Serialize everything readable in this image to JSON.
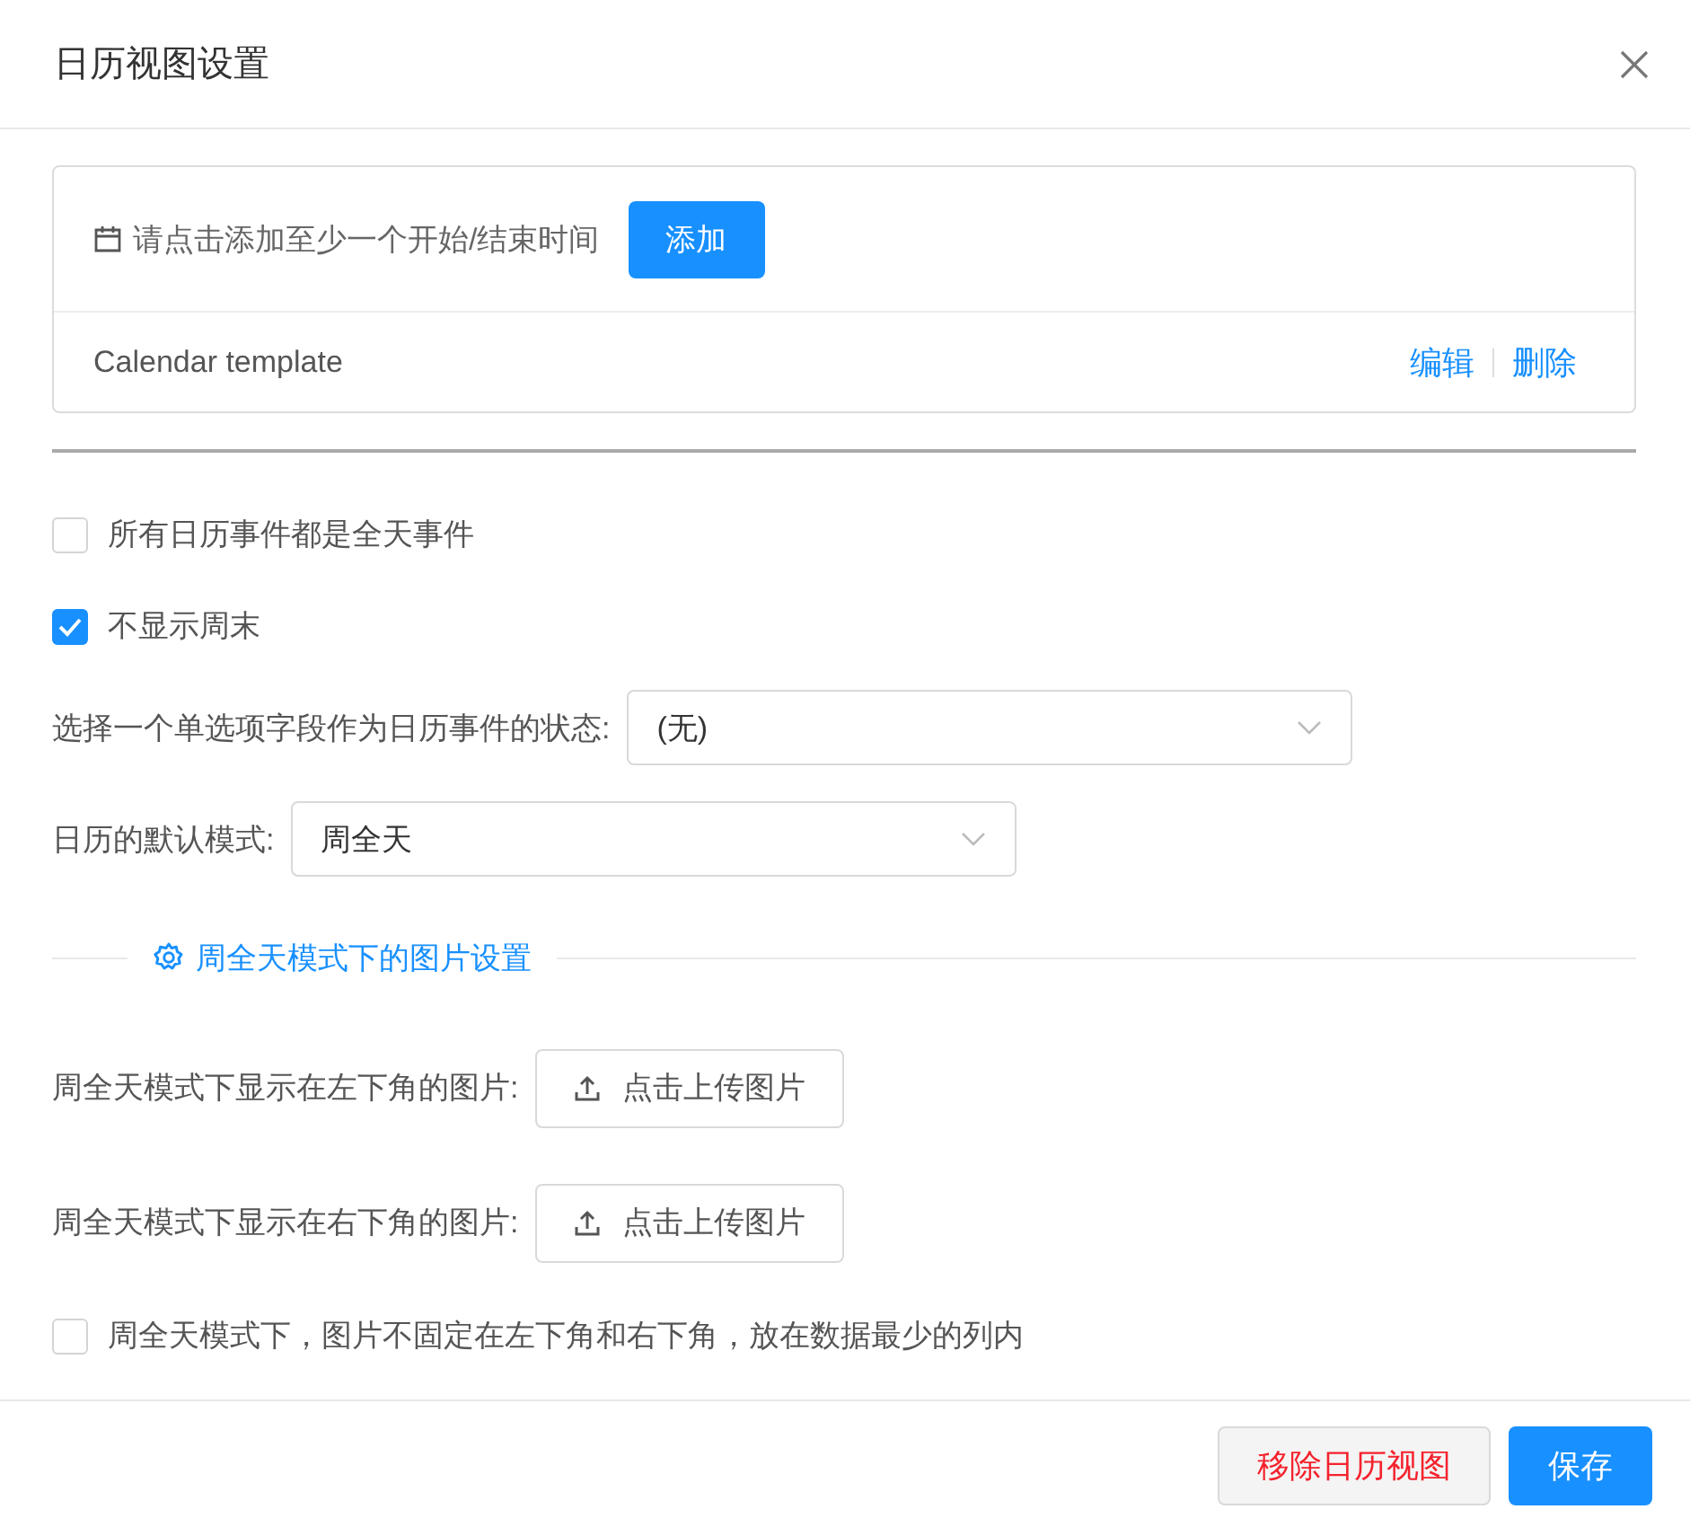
{
  "dialog": {
    "title": "日历视图设置"
  },
  "card": {
    "prompt": "请点击添加至少一个开始/结束时间",
    "add_button": "添加",
    "template_name": "Calendar template",
    "actions": [
      "编辑",
      "删除"
    ]
  },
  "settings": [
    {
      "kind": "checkbox",
      "label": "所有日历事件都是全天事件",
      "checked": false
    },
    {
      "kind": "checkbox",
      "label": "不显示周末",
      "checked": true
    },
    {
      "kind": "select",
      "label": "选择一个单选项字段作为日历事件的状态:",
      "value": "(无)"
    },
    {
      "kind": "select",
      "label": "日历的默认模式:",
      "value": "周全天"
    },
    {
      "kind": "section",
      "title": "周全天模式下的图片设置"
    },
    {
      "kind": "upload",
      "label": "周全天模式下显示在左下角的图片:",
      "button": "点击上传图片"
    },
    {
      "kind": "upload",
      "label": "周全天模式下显示在右下角的图片:",
      "button": "点击上传图片"
    },
    {
      "kind": "checkbox",
      "label": "周全天模式下，图片不固定在左下角和右下角，放在数据最少的列内",
      "checked": false
    }
  ],
  "footer": [
    {
      "kind": "danger",
      "label": "移除日历视图"
    },
    {
      "kind": "primary",
      "label": "保存"
    }
  ]
}
